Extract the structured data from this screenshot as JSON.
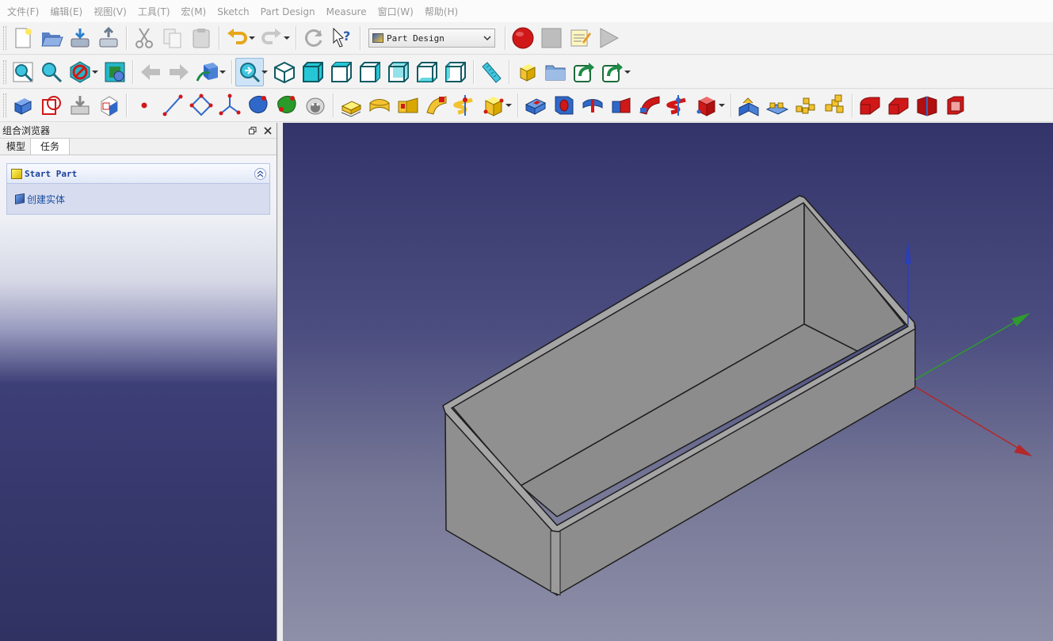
{
  "menu": [
    "文件(F)",
    "编辑(E)",
    "视图(V)",
    "工具(T)",
    "宏(M)",
    "Sketch",
    "Part Design",
    "Measure",
    "窗口(W)",
    "帮助(H)"
  ],
  "workbench": {
    "selected": "Part Design",
    "icon": "part-design-workbench-icon"
  },
  "toolbar1": [
    {
      "name": "new-icon"
    },
    {
      "name": "open-icon"
    },
    {
      "name": "save-icon"
    },
    {
      "name": "save-as-icon"
    },
    {
      "name": "cut-icon"
    },
    {
      "name": "copy-icon"
    },
    {
      "name": "paste-icon"
    },
    {
      "name": "undo-icon"
    },
    {
      "name": "redo-icon"
    },
    {
      "name": "refresh-icon"
    },
    {
      "name": "whats-this-icon"
    },
    {
      "name": "macro-record-icon"
    },
    {
      "name": "macro-stop-icon"
    },
    {
      "name": "macro-edit-icon"
    },
    {
      "name": "macro-run-icon"
    }
  ],
  "colors": {
    "accent": "#3a8fd3",
    "record": "#d01818",
    "cyan_view": "#2ec7d8",
    "part_yellow": "#f2c231",
    "pd_red": "#d41c1c",
    "pd_blue": "#2f68c8",
    "axis_x": "#b42828",
    "axis_y": "#2d9b2d",
    "axis_z": "#2a3fb8",
    "model_face": "#8d8d8d"
  },
  "panel": {
    "title": "组合浏览器",
    "tabs": [
      "模型",
      "任务"
    ],
    "selected_tab": "任务",
    "task": {
      "title": "Start Part",
      "action": "创建实体"
    }
  },
  "viewport": {
    "model": "open-box",
    "axes": [
      "X",
      "Y",
      "Z"
    ]
  }
}
